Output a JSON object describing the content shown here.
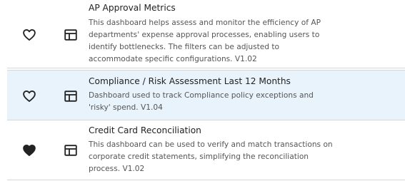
{
  "dashboards": [
    {
      "title": "AP Approval Metrics",
      "description": "This dashboard helps assess and monitor the efficiency of AP departments' expense approval processes, enabling users to identify bottlenecks. The filters can be adjusted to accommodate specific configurations. V1.02",
      "favorite": false,
      "favorite_icon": "heart-outline-icon",
      "type_icon": "dashboard-layout-icon",
      "selected": false
    },
    {
      "title": "Compliance / Risk Assessment Last 12 Months",
      "description": "Dashboard used to track Compliance policy exceptions and 'risky' spend. V1.04",
      "favorite": false,
      "favorite_icon": "heart-outline-icon",
      "type_icon": "dashboard-layout-icon",
      "selected": true
    },
    {
      "title": "Credit Card Reconciliation",
      "description": "This dashboard can be used to verify and match transactions on corporate credit statements, simplifying the reconciliation process. V1.02",
      "favorite": true,
      "favorite_icon": "heart-filled-icon",
      "type_icon": "dashboard-layout-icon",
      "selected": false
    }
  ],
  "colors": {
    "selected_row_bg": "#e9f3fb",
    "divider": "#d7d7d7",
    "icon": "#222222",
    "title_text": "#222222",
    "description_text": "#555555"
  }
}
